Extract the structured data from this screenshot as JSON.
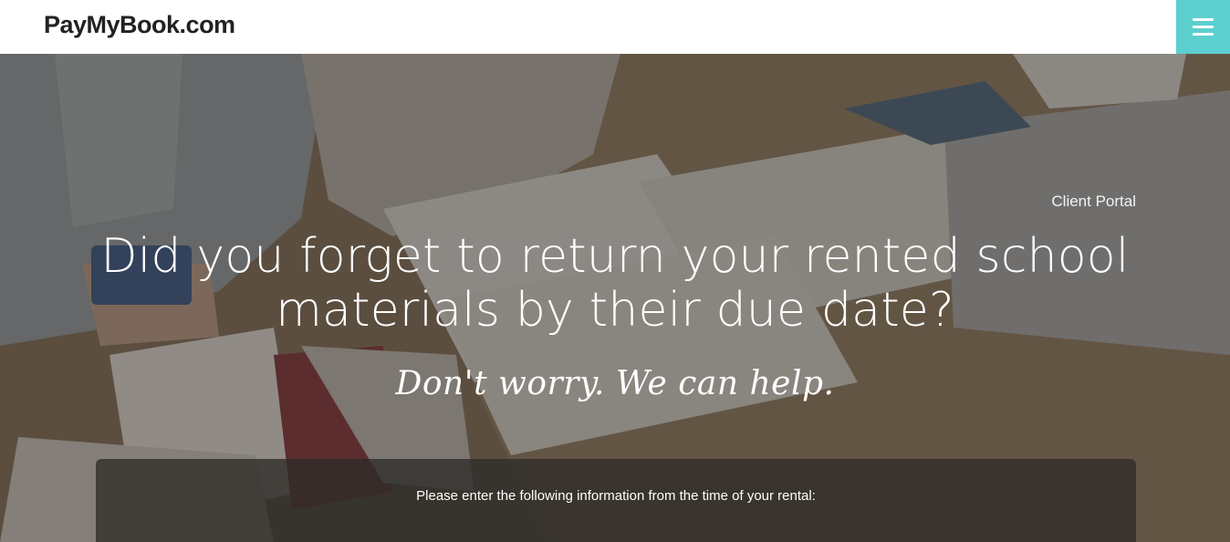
{
  "header": {
    "logo": "PayMyBook.com",
    "menu_icon": "hamburger-menu-icon",
    "menu_color": "#5ccfcf"
  },
  "hero": {
    "client_portal_link": "Client Portal",
    "headline": "Did you forget to return your rented school materials by their due date?",
    "tagline": "Don't worry. We can help."
  },
  "form": {
    "instructions": "Please enter the following information from the time of your rental:"
  }
}
